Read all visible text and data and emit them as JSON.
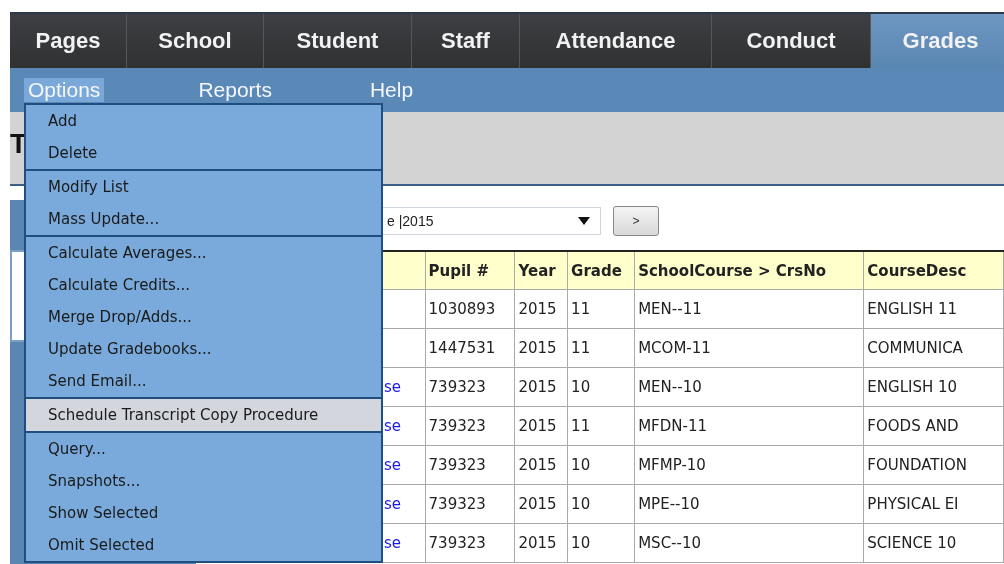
{
  "tabs": [
    {
      "label": "Pages",
      "selected": false
    },
    {
      "label": "School",
      "selected": false
    },
    {
      "label": "Student",
      "selected": false
    },
    {
      "label": "Staff",
      "selected": false
    },
    {
      "label": "Attendance",
      "selected": false
    },
    {
      "label": "Conduct",
      "selected": false
    },
    {
      "label": "Grades",
      "selected": true
    }
  ],
  "menu_bar": [
    {
      "label": "Options",
      "selected": true
    },
    {
      "label": "Reports",
      "selected": false
    },
    {
      "label": "Help",
      "selected": false
    }
  ],
  "page_title": "T",
  "options_menu": [
    [
      {
        "label": "Add",
        "highlighted": false
      },
      {
        "label": "Delete",
        "highlighted": false
      }
    ],
    [
      {
        "label": "Modify List",
        "highlighted": false
      },
      {
        "label": "Mass Update...",
        "highlighted": false
      }
    ],
    [
      {
        "label": "Calculate Averages...",
        "highlighted": false
      },
      {
        "label": "Calculate Credits...",
        "highlighted": false
      },
      {
        "label": "Merge Drop/Adds...",
        "highlighted": false
      },
      {
        "label": "Update Gradebooks...",
        "highlighted": false
      },
      {
        "label": "Send Email...",
        "highlighted": false
      }
    ],
    [
      {
        "label": "Schedule Transcript Copy Procedure",
        "highlighted": true
      }
    ],
    [
      {
        "label": "Query...",
        "highlighted": false
      },
      {
        "label": "Snapshots...",
        "highlighted": false
      },
      {
        "label": "Show Selected",
        "highlighted": false
      },
      {
        "label": "Omit Selected",
        "highlighted": false
      }
    ]
  ],
  "filter_select": {
    "value": "e |2015"
  },
  "go_button": {
    "label": ">"
  },
  "table": {
    "columns": [
      "",
      "Pupil #",
      "Year",
      "Grade",
      "SchoolCourse > CrsNo",
      "CourseDesc"
    ],
    "rows": [
      [
        "",
        "1030893",
        "2015",
        "11",
        "MEN--11",
        "ENGLISH 11"
      ],
      [
        "",
        "1447531",
        "2015",
        "11",
        "MCOM-11",
        "COMMUNICA"
      ],
      [
        "se",
        "739323",
        "2015",
        "10",
        "MEN--10",
        "ENGLISH 10"
      ],
      [
        "se",
        "739323",
        "2015",
        "11",
        "MFDN-11",
        "FOODS AND"
      ],
      [
        "se",
        "739323",
        "2015",
        "10",
        "MFMP-10",
        "FOUNDATION"
      ],
      [
        "se",
        "739323",
        "2015",
        "10",
        "MPE--10",
        "PHYSICAL EI"
      ],
      [
        "se",
        "739323",
        "2015",
        "10",
        "MSC--10",
        "SCIENCE 10"
      ]
    ]
  }
}
